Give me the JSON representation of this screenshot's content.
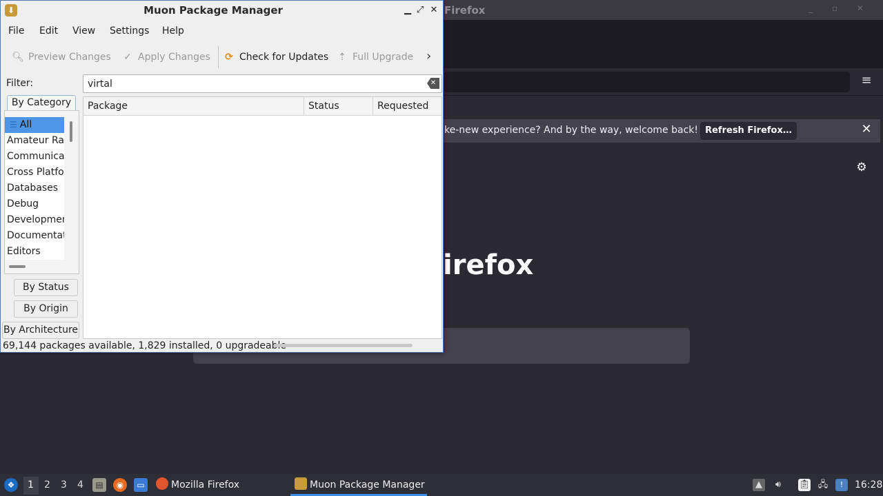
{
  "firefox": {
    "window_title": "Firefox",
    "notice_text": "ke-new experience? And by the way, welcome back!",
    "refresh_label": "Refresh Firefox…",
    "logo_text": "irefox"
  },
  "muon": {
    "title": "Muon Package Manager",
    "menu": [
      "File",
      "Edit",
      "View",
      "Settings",
      "Help"
    ],
    "toolbar": {
      "preview_changes": "Preview Changes",
      "apply_changes": "Apply Changes",
      "check_for_updates": "Check for Updates",
      "full_upgrade": "Full Upgrade"
    },
    "filter": {
      "label": "Filter:",
      "value": "virtal"
    },
    "side_tabs": {
      "by_category": "By Category",
      "by_status": "By Status",
      "by_origin": "By Origin",
      "by_architecture": "By Architecture"
    },
    "categories": [
      "All",
      "Amateur Radio",
      "Communication",
      "Cross Platform",
      "Databases",
      "Debug",
      "Development",
      "Documentation",
      "Editors"
    ],
    "selected_category": "All",
    "table_columns": [
      "Package",
      "Status",
      "Requested"
    ],
    "status_text": "69,144 packages available, 1,829 installed, 0 upgradeable"
  },
  "taskbar": {
    "desktops": [
      "1",
      "2",
      "3",
      "4"
    ],
    "active_desktop": "1",
    "tasks": [
      "Mozilla Firefox",
      "Muon Package Manager"
    ],
    "clock": "16:28"
  },
  "colors": {
    "accent": "#4d95e5",
    "firefox_bg": "#2b2a33",
    "taskbar_bg": "#2e2e36"
  }
}
